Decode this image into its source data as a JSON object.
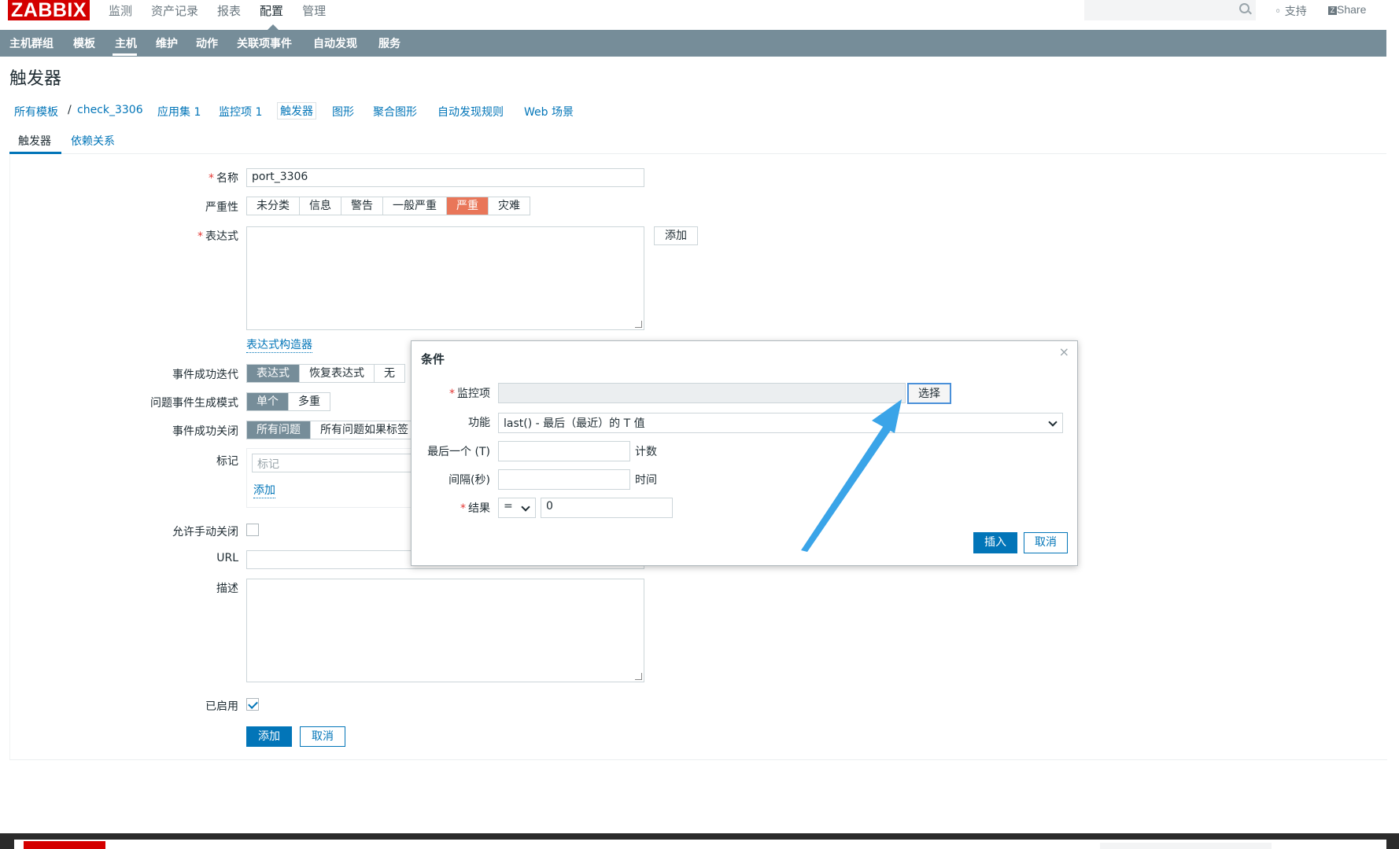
{
  "app": {
    "logo": "ZABBIX"
  },
  "top_menu": [
    {
      "label": "监测",
      "active": false
    },
    {
      "label": "资产记录",
      "active": false
    },
    {
      "label": "报表",
      "active": false
    },
    {
      "label": "配置",
      "active": true
    },
    {
      "label": "管理",
      "active": false
    }
  ],
  "header_right": {
    "support": "支持",
    "share": "Share"
  },
  "nav": [
    "主机群组",
    "模板",
    "主机",
    "维护",
    "动作",
    "关联项事件",
    "自动发现",
    "服务"
  ],
  "nav_active": "主机",
  "page_title": "触发器",
  "breadcrumbs": [
    "所有模板",
    "/",
    "check_3306",
    "应用集 1",
    "监控项 1",
    "触发器",
    "图形",
    "聚合图形",
    "自动发现规则",
    "Web 场景"
  ],
  "tabs": [
    "触发器",
    "依赖关系"
  ],
  "form": {
    "name_label": "名称",
    "name_value": "port_3306",
    "severity_label": "严重性",
    "severity_options": [
      "未分类",
      "信息",
      "警告",
      "一般严重",
      "严重",
      "灾难"
    ],
    "severity_selected": "严重",
    "expression_label": "表达式",
    "add_label": "添加",
    "expression_builder": "表达式构造器",
    "ok_event_gen_label": "事件成功迭代",
    "ok_event_gen_options": [
      "表达式",
      "恢复表达式",
      "无"
    ],
    "problem_mode_label": "问题事件生成模式",
    "problem_mode_options": [
      "单个",
      "多重"
    ],
    "ok_close_label": "事件成功关闭",
    "ok_close_options": [
      "所有问题",
      "所有问题如果标签"
    ],
    "tags_label": "标记",
    "tag_placeholder": "标记",
    "tag_add": "添加",
    "manual_close_label": "允许手动关闭",
    "url_label": "URL",
    "description_label": "描述",
    "enabled_label": "已启用",
    "submit_label": "添加",
    "cancel_label": "取消"
  },
  "dialog": {
    "title": "条件",
    "close": "×",
    "item_label": "监控项",
    "select_button": "选择",
    "function_label": "功能",
    "function_value": "last() - 最后（最近）的 T 值",
    "last_t_label": "最后一个 (T)",
    "last_t_suffix": "计数",
    "interval_label": "间隔(秒)",
    "interval_suffix": "时间",
    "result_label": "结果",
    "result_operator": "=",
    "result_value": "0",
    "insert_button": "插入",
    "cancel_button": "取消"
  },
  "colors": {
    "accent": "#0275b8",
    "nav": "#768d99",
    "logo": "#d40000",
    "arrow": "#3aa4e8",
    "severity_high": "#e97659"
  }
}
